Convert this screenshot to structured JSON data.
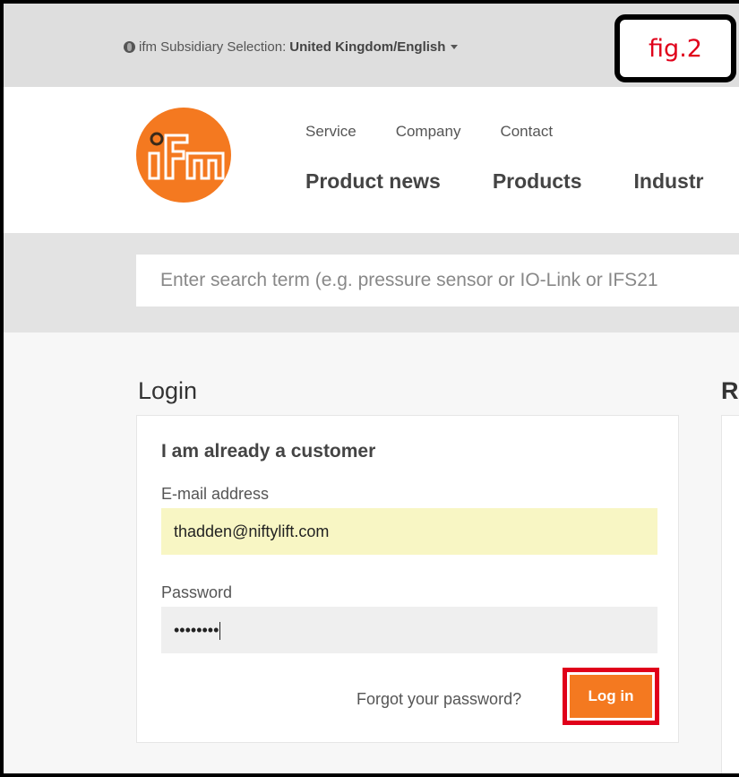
{
  "topbar": {
    "subsidiary_label": "ifm Subsidiary Selection:",
    "subsidiary_value": "United Kingdom/English"
  },
  "figure_label": "fig.2",
  "header": {
    "logo_text": "ifm",
    "service_nav": [
      "Service",
      "Company",
      "Contact"
    ],
    "main_nav": [
      "Product news",
      "Products",
      "Industr"
    ]
  },
  "search": {
    "placeholder": "Enter search term (e.g. pressure sensor or IO-Link or IFS21"
  },
  "login": {
    "title": "Login",
    "right_title": "R",
    "panel_heading": "I am already a customer",
    "email_label": "E-mail address",
    "email_value": "thadden@niftylift.com",
    "password_label": "Password",
    "password_value": "••••••••",
    "forgot_link": "Forgot your password?",
    "login_button": "Log in"
  },
  "colors": {
    "brand_orange": "#f47920",
    "highlight_red": "#e0001a",
    "autofill_yellow": "#f8f6c4"
  }
}
